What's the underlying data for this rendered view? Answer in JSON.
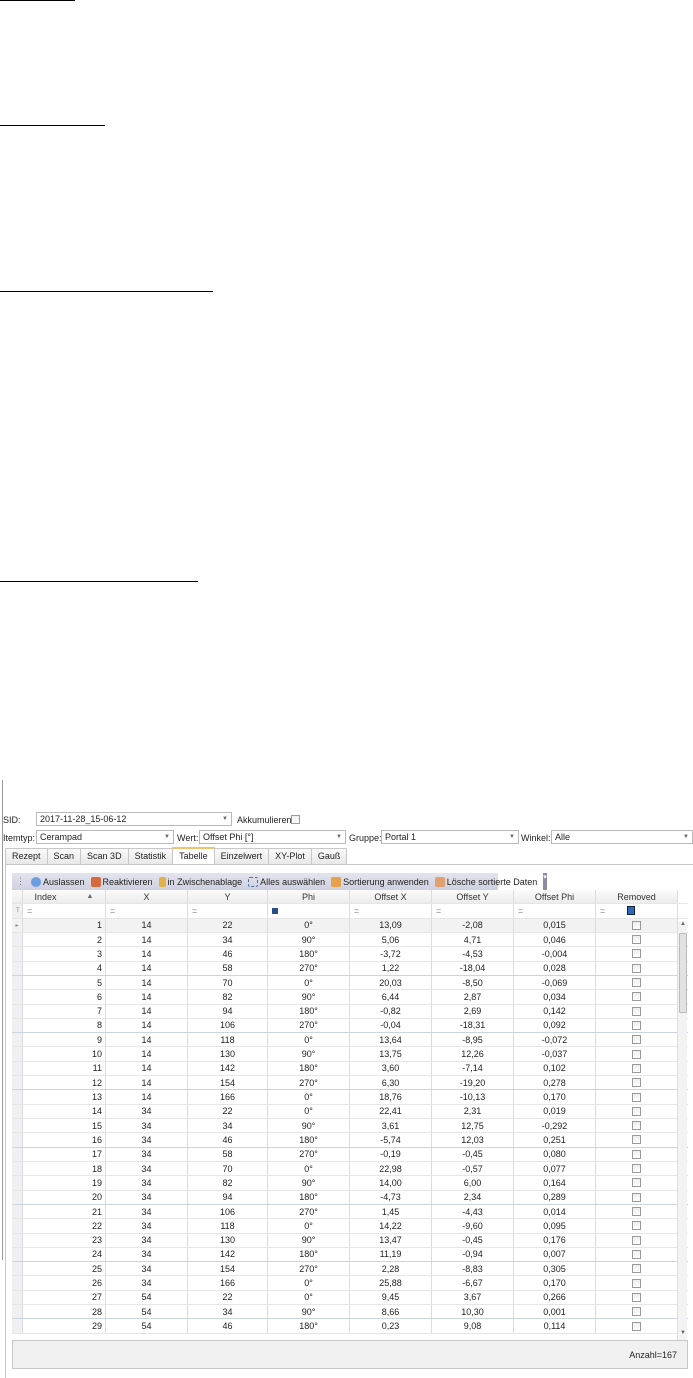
{
  "filters": {
    "sid_label": "SID:",
    "sid_value": "2017-11-28_15-06-12",
    "akkumulieren_label": "Akkumulieren:",
    "itemtyp_label": "Itemtyp:",
    "itemtyp_value": "Cerampad",
    "wert_label": "Wert:",
    "wert_value": "Offset Phi [°]",
    "gruppe_label": "Gruppe:",
    "gruppe_value": "Portal 1",
    "winkel_label": "Winkel:",
    "winkel_value": "Alle"
  },
  "tabs": [
    "Rezept",
    "Scan",
    "Scan 3D",
    "Statistik",
    "Tabelle",
    "Einzelwert",
    "XY-Plot",
    "Gauß"
  ],
  "active_tab": "Tabelle",
  "toolbar": {
    "auslassen": "Auslassen",
    "reaktivieren": "Reaktivieren",
    "zwischenablage": "in Zwischenablage",
    "alles_auswaehlen": "Alles auswählen",
    "sortierung": "Sortierung anwenden",
    "loesche": "Lösche sortierte Daten"
  },
  "table": {
    "columns": [
      "Index",
      "X",
      "Y",
      "Phi",
      "Offset X",
      "Offset Y",
      "Offset Phi",
      "Removed"
    ],
    "filter_symbol": "=",
    "rows": [
      [
        "1",
        "14",
        "22",
        "0°",
        "13,09",
        "-2,08",
        "0,015"
      ],
      [
        "2",
        "14",
        "34",
        "90°",
        "5,06",
        "4,71",
        "0,046"
      ],
      [
        "3",
        "14",
        "46",
        "180°",
        "-3,72",
        "-4,53",
        "-0,004"
      ],
      [
        "4",
        "14",
        "58",
        "270°",
        "1,22",
        "-18,04",
        "0,028"
      ],
      [
        "5",
        "14",
        "70",
        "0°",
        "20,03",
        "-8,50",
        "-0,069"
      ],
      [
        "6",
        "14",
        "82",
        "90°",
        "6,44",
        "2,87",
        "0,034"
      ],
      [
        "7",
        "14",
        "94",
        "180°",
        "-0,82",
        "2,69",
        "0,142"
      ],
      [
        "8",
        "14",
        "106",
        "270°",
        "-0,04",
        "-18,31",
        "0,092"
      ],
      [
        "9",
        "14",
        "118",
        "0°",
        "13,64",
        "-8,95",
        "-0,072"
      ],
      [
        "10",
        "14",
        "130",
        "90°",
        "13,75",
        "12,26",
        "-0,037"
      ],
      [
        "11",
        "14",
        "142",
        "180°",
        "3,60",
        "-7,14",
        "0,102"
      ],
      [
        "12",
        "14",
        "154",
        "270°",
        "6,30",
        "-19,20",
        "0,278"
      ],
      [
        "13",
        "14",
        "166",
        "0°",
        "18,76",
        "-10,13",
        "0,170"
      ],
      [
        "14",
        "34",
        "22",
        "0°",
        "22,41",
        "2,31",
        "0,019"
      ],
      [
        "15",
        "34",
        "34",
        "90°",
        "3,61",
        "12,75",
        "-0,292"
      ],
      [
        "16",
        "34",
        "46",
        "180°",
        "-5,74",
        "12,03",
        "0,251"
      ],
      [
        "17",
        "34",
        "58",
        "270°",
        "-0,19",
        "-0,45",
        "0,080"
      ],
      [
        "18",
        "34",
        "70",
        "0°",
        "22,98",
        "-0,57",
        "0,077"
      ],
      [
        "19",
        "34",
        "82",
        "90°",
        "14,00",
        "6,00",
        "0,164"
      ],
      [
        "20",
        "34",
        "94",
        "180°",
        "-4,73",
        "2,34",
        "0,289"
      ],
      [
        "21",
        "34",
        "106",
        "270°",
        "1,45",
        "-4,43",
        "0,014"
      ],
      [
        "22",
        "34",
        "118",
        "0°",
        "14,22",
        "-9,60",
        "0,095"
      ],
      [
        "23",
        "34",
        "130",
        "90°",
        "13,47",
        "-0,45",
        "0,176"
      ],
      [
        "24",
        "34",
        "142",
        "180°",
        "11,19",
        "-0,94",
        "0,007"
      ],
      [
        "25",
        "34",
        "154",
        "270°",
        "2,28",
        "-8,83",
        "0,305"
      ],
      [
        "26",
        "34",
        "166",
        "0°",
        "25,88",
        "-6,67",
        "0,170"
      ],
      [
        "27",
        "54",
        "22",
        "0°",
        "9,45",
        "3,67",
        "0,266"
      ],
      [
        "28",
        "54",
        "34",
        "90°",
        "8,66",
        "10,30",
        "0,001"
      ],
      [
        "29",
        "54",
        "46",
        "180°",
        "0,23",
        "9,08",
        "0,114"
      ]
    ]
  },
  "footer": {
    "count": "Anzahl=167"
  }
}
